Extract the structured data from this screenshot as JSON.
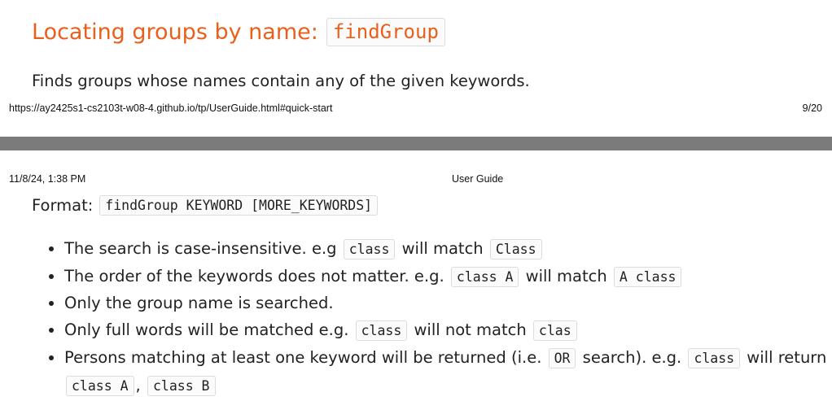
{
  "section": {
    "heading_text": "Locating groups by name:",
    "heading_code": "findGroup",
    "description": "Finds groups whose names contain any of the given keywords."
  },
  "page_footer": {
    "url": "https://ay2425s1-cs2103t-w08-4.github.io/tp/UserGuide.html#quick-start",
    "page_number": "9/20"
  },
  "page_header": {
    "date": "11/8/24, 1:38 PM",
    "title": "User Guide"
  },
  "format": {
    "label": "Format:",
    "code": "findGroup KEYWORD [MORE_KEYWORDS]"
  },
  "bullets": [
    {
      "t1": "The search is case-insensitive. e.g ",
      "c1": "class",
      "t2": " will match ",
      "c2": "Class"
    },
    {
      "t1": "The order of the keywords does not matter. e.g. ",
      "c1": "class A",
      "t2": " will match ",
      "c2": "A class"
    },
    {
      "t1": "Only the group name is searched."
    },
    {
      "t1": "Only full words will be matched e.g. ",
      "c1": "class",
      "t2": " will not match ",
      "c2": "clas"
    },
    {
      "t1": "Persons matching at least one keyword will be returned (i.e. ",
      "c1": "OR",
      "t2": " search). e.g. ",
      "c2": "class",
      "t3": " will return",
      "c3": "class A",
      "t4": ", ",
      "c4": "class B"
    }
  ]
}
